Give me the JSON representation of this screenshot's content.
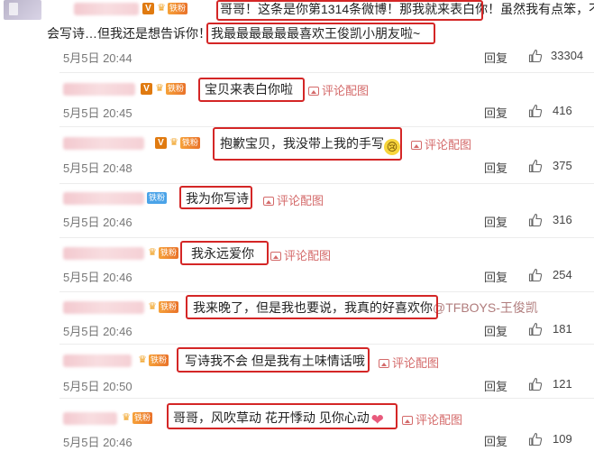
{
  "main_post": {
    "lines": [
      "哥哥！这条是你第1314条微博！那我就来表白你！虽然我有点笨，不",
      "会写诗…但我还是想告诉你！我最最最最最最喜欢王俊凯小朋友啦~"
    ],
    "time": "5月5日 20:44",
    "reply_label": "回复",
    "likes": "33304",
    "badge_text": "铁粉"
  },
  "comments": [
    {
      "text": "宝贝来表白你啦",
      "pic_label": "评论配图",
      "time": "5月5日 20:45",
      "reply_label": "回复",
      "likes": "416",
      "badge_text": "铁粉"
    },
    {
      "text": "抱歉宝贝，我没带上我的手写",
      "emoji": "cry",
      "pic_label": "评论配图",
      "time": "5月5日 20:48",
      "reply_label": "回复",
      "likes": "375",
      "badge_text": "铁粉"
    },
    {
      "text": "我为你写诗",
      "pic_label": "评论配图",
      "time": "5月5日 20:46",
      "reply_label": "回复",
      "likes": "316",
      "badge_text": "铁粉"
    },
    {
      "text": "我永远爱你",
      "pic_label": "评论配图",
      "time": "5月5日 20:46",
      "reply_label": "回复",
      "likes": "254",
      "badge_text": "铁粉"
    },
    {
      "text": "我来晚了，但是我也要说，我真的好喜欢你",
      "mention": "@TFBOYS-王俊凯",
      "time": "5月5日 20:46",
      "reply_label": "回复",
      "likes": "181",
      "badge_text": "铁粉"
    },
    {
      "text": "写诗我不会 但是我有土味情话哦",
      "pic_label": "评论配图",
      "time": "5月5日 20:50",
      "reply_label": "回复",
      "likes": "121",
      "badge_text": "铁粉"
    },
    {
      "text": "哥哥，风吹草动 花开悸动 见你心动",
      "emoji": "heart",
      "pic_label": "评论配图",
      "time": "5月5日 20:46",
      "reply_label": "回复",
      "likes": "109",
      "badge_text": "铁粉"
    }
  ],
  "colors": {
    "highlight_box": "#d42626",
    "pic_link": "#d46a6a",
    "fan_badge": "#e9722a"
  },
  "icons": {
    "like": "thumbs-up-icon",
    "picture": "image-icon",
    "vip": "v-badge-icon",
    "crown": "crown-icon"
  }
}
